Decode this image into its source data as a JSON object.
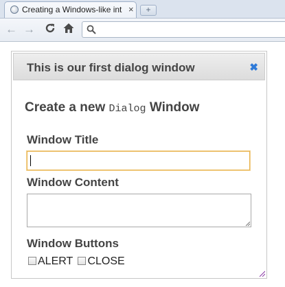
{
  "browser": {
    "tab_title": "Creating a Windows-like int",
    "tab_close": "×",
    "new_tab": "+",
    "background_tab_text": "",
    "nav": {
      "back": "←",
      "forward": "→",
      "reload": "C",
      "home": "⌂"
    },
    "omnibox_value": ""
  },
  "dialog": {
    "title": "This is our first dialog window",
    "close_glyph": "✖",
    "heading_before": "Create a new",
    "heading_code": "Dialog",
    "heading_after": "Window",
    "fields": {
      "title_label": "Window Title",
      "title_value": "",
      "content_label": "Window Content",
      "content_value": "",
      "buttons_label": "Window Buttons",
      "options": [
        "ALERT",
        "CLOSE"
      ]
    }
  },
  "colors": {
    "close_accent": "#2e7ad8",
    "focus_border": "#e8b24a",
    "header_bg": "#dcdcdc"
  }
}
